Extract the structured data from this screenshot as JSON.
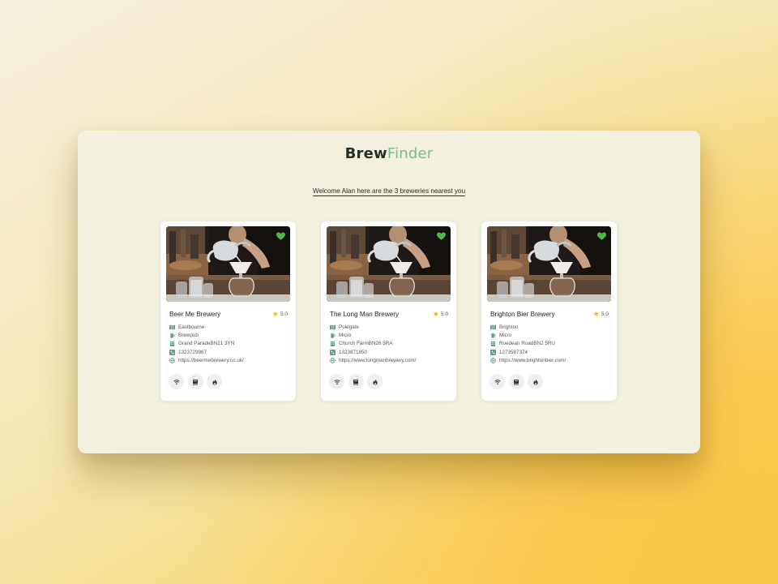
{
  "app": {
    "logo_brew": "Brew",
    "logo_finder": "Finder",
    "welcome": "Welcome Alan here are the 3 breweries nearest you"
  },
  "colors": {
    "brand_dark": "#243027",
    "brand_green": "#7fb89a",
    "favorite_green": "#4cb848",
    "star_yellow": "#f0b51e",
    "icon_teal": "#6a9a8a"
  },
  "breweries": [
    {
      "name": "Beer Me Brewery",
      "rating": "5.0",
      "town": "Eastbourne",
      "type": "Brewpub",
      "address": "Grand ParadeBN21 3YN",
      "phone": "1323729967",
      "website": "https://beermebrewery.co.uk/"
    },
    {
      "name": "The Long Man Brewery",
      "rating": "5.0",
      "town": "Polegate",
      "type": "Micro",
      "address": "Church FarmBN26 5RA",
      "phone": "1323871850",
      "website": "https://www.longmanbrewery.com/"
    },
    {
      "name": "Brighton Bier Brewery",
      "rating": "5.0",
      "town": "Brighton",
      "type": "Micro",
      "address": "Roedean RoadBN2 5RU",
      "phone": "1273587374",
      "website": "https://www.brightonbier.com/"
    }
  ],
  "icons": {
    "favorite": "heart-icon",
    "rating": "star-icon",
    "town": "map-icon",
    "type": "beer-icon",
    "address": "building-icon",
    "phone": "phone-icon",
    "website": "globe-icon",
    "amenities": [
      "wifi-icon",
      "food-icon",
      "fire-icon"
    ]
  }
}
